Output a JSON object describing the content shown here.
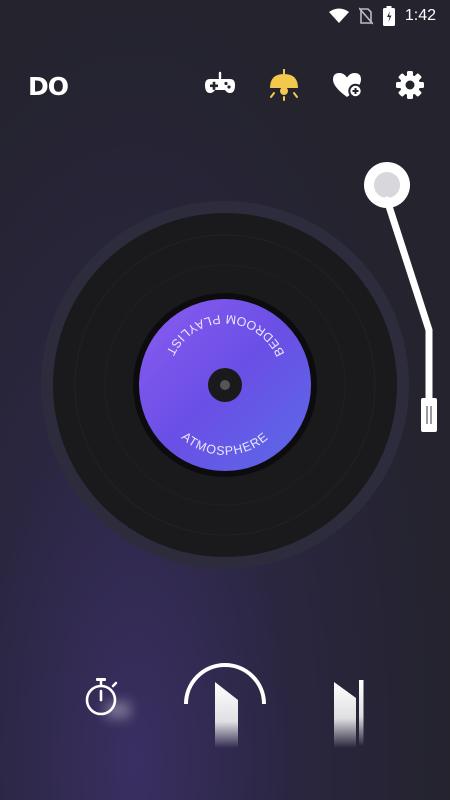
{
  "status_bar": {
    "time": "1:42"
  },
  "header": {
    "logo_text": "DO",
    "icons": [
      "gamepad-icon",
      "lamp-icon",
      "heart-icon",
      "gear-icon"
    ]
  },
  "record": {
    "label_top": "BEDROOM PLAYLIST",
    "label_bottom": "ATMOSPHERE"
  },
  "controls": {
    "buttons": [
      "timer-icon",
      "play-icon",
      "next-track-icon"
    ]
  },
  "colors": {
    "accent_lamp": "#f2c94c",
    "label_purple": "#6f4fe6",
    "background": "#24232e"
  }
}
